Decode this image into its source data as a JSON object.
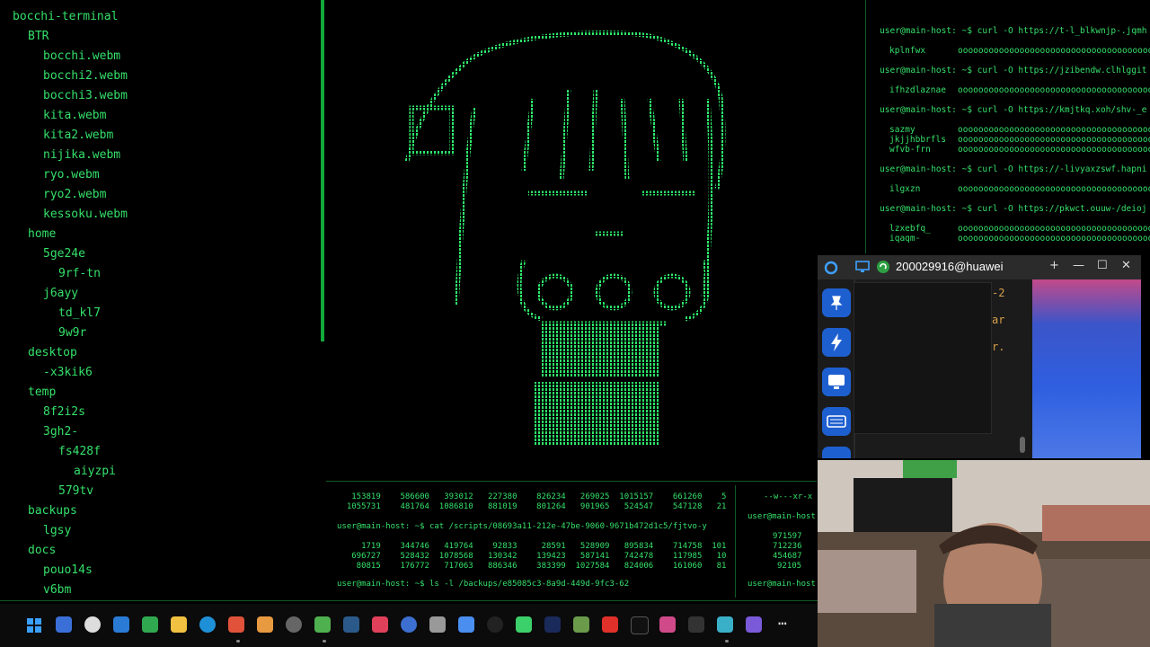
{
  "tree": {
    "items": [
      {
        "label": "bocchi-terminal",
        "indent": 0
      },
      {
        "label": "BTR",
        "indent": 1
      },
      {
        "label": "bocchi.webm",
        "indent": 2
      },
      {
        "label": "bocchi2.webm",
        "indent": 2
      },
      {
        "label": "bocchi3.webm",
        "indent": 2
      },
      {
        "label": "kita.webm",
        "indent": 2
      },
      {
        "label": "kita2.webm",
        "indent": 2
      },
      {
        "label": "nijika.webm",
        "indent": 2
      },
      {
        "label": "ryo.webm",
        "indent": 2
      },
      {
        "label": "ryo2.webm",
        "indent": 2
      },
      {
        "label": "kessoku.webm",
        "indent": 2
      },
      {
        "label": "home",
        "indent": 1
      },
      {
        "label": "5ge24e",
        "indent": 2
      },
      {
        "label": "9rf-tn",
        "indent": 3
      },
      {
        "label": "j6ayy",
        "indent": 2
      },
      {
        "label": "td_kl7",
        "indent": 3
      },
      {
        "label": "9w9r",
        "indent": 3
      },
      {
        "label": "desktop",
        "indent": 1
      },
      {
        "label": "-x3kik6",
        "indent": 2
      },
      {
        "label": "temp",
        "indent": 1
      },
      {
        "label": "8f2i2s",
        "indent": 2
      },
      {
        "label": "3gh2-",
        "indent": 2
      },
      {
        "label": "fs428f",
        "indent": 3
      },
      {
        "label": "aiyzpi",
        "indent": 4
      },
      {
        "label": "579tv",
        "indent": 3
      },
      {
        "label": "backups",
        "indent": 1
      },
      {
        "label": "lgsy",
        "indent": 2
      },
      {
        "label": "docs",
        "indent": 1
      },
      {
        "label": "pouo14s",
        "indent": 2
      },
      {
        "label": "v6bm",
        "indent": 2
      }
    ]
  },
  "terminal_bottom": {
    "line1": "   153819    586600   393012   227380    826234   269025  1015157    661260    5",
    "line2": "  1055731    481764  1086810   881019    801264   901965   524547    547128   21",
    "prompt1": "user@main-host: ~$ cat /scripts/08693a11-212e-47be-9060-9671b472d1c5/fjtvo-y",
    "line3": "     1719    344746   419764    92833     28591   528909   895834    714758  101",
    "line4": "   696727    528432  1078568   130342    139423   587141   742478    117985   10",
    "line5": "    80815    176772   717063   886346    383399  1027584   824006    161060   81",
    "prompt2": "user@main-host: ~$ ls -l /backups/e85085c3-8a9d-449d-9fc3-62"
  },
  "terminal_right_small": {
    "perm": "--w---xr-x",
    "prompt1": "user@main-host",
    "n1": "971597",
    "n2": "712236",
    "n3": "454687",
    "n4": "92105",
    "prompt2": "user@main-host"
  },
  "log": {
    "lines": [
      {
        "left": "user@main-host: ~$ curl -O https://t-l_blkwnjp-.jqmh",
        "kind": "prompt"
      },
      {
        "left": "kplnfwx",
        "kind": "name"
      },
      {
        "left": "user@main-host: ~$ curl -O https://jzibendw.clhlggit",
        "kind": "prompt"
      },
      {
        "left": "ifhzdlaznae",
        "kind": "name"
      },
      {
        "left": "user@main-host: ~$ curl -O https://kmjtkq.xoh/shv-_e",
        "kind": "prompt"
      },
      {
        "left": "sazmy",
        "kind": "name"
      },
      {
        "left": "jkjjhbbrfls",
        "kind": "name"
      },
      {
        "left": "wfvb-frn",
        "kind": "name"
      },
      {
        "left": "user@main-host: ~$ curl -O https://-livyaxzswf.hapni",
        "kind": "prompt"
      },
      {
        "left": "ilgxzn",
        "kind": "name"
      },
      {
        "left": "user@main-host: ~$ curl -O https://pkwct.ouuw-/deioj",
        "kind": "prompt"
      },
      {
        "left": "lzxebfq_",
        "kind": "name"
      },
      {
        "left": "iqaqm-",
        "kind": "name"
      }
    ],
    "progress_fill": "oooooooooooooooooooooooooooooooooooooooooooooooo"
  },
  "window": {
    "title": "200029916@huawei",
    "side_text": [
      "-2",
      "ar",
      "r."
    ]
  },
  "taskbar": {
    "label": "Taskbar"
  }
}
